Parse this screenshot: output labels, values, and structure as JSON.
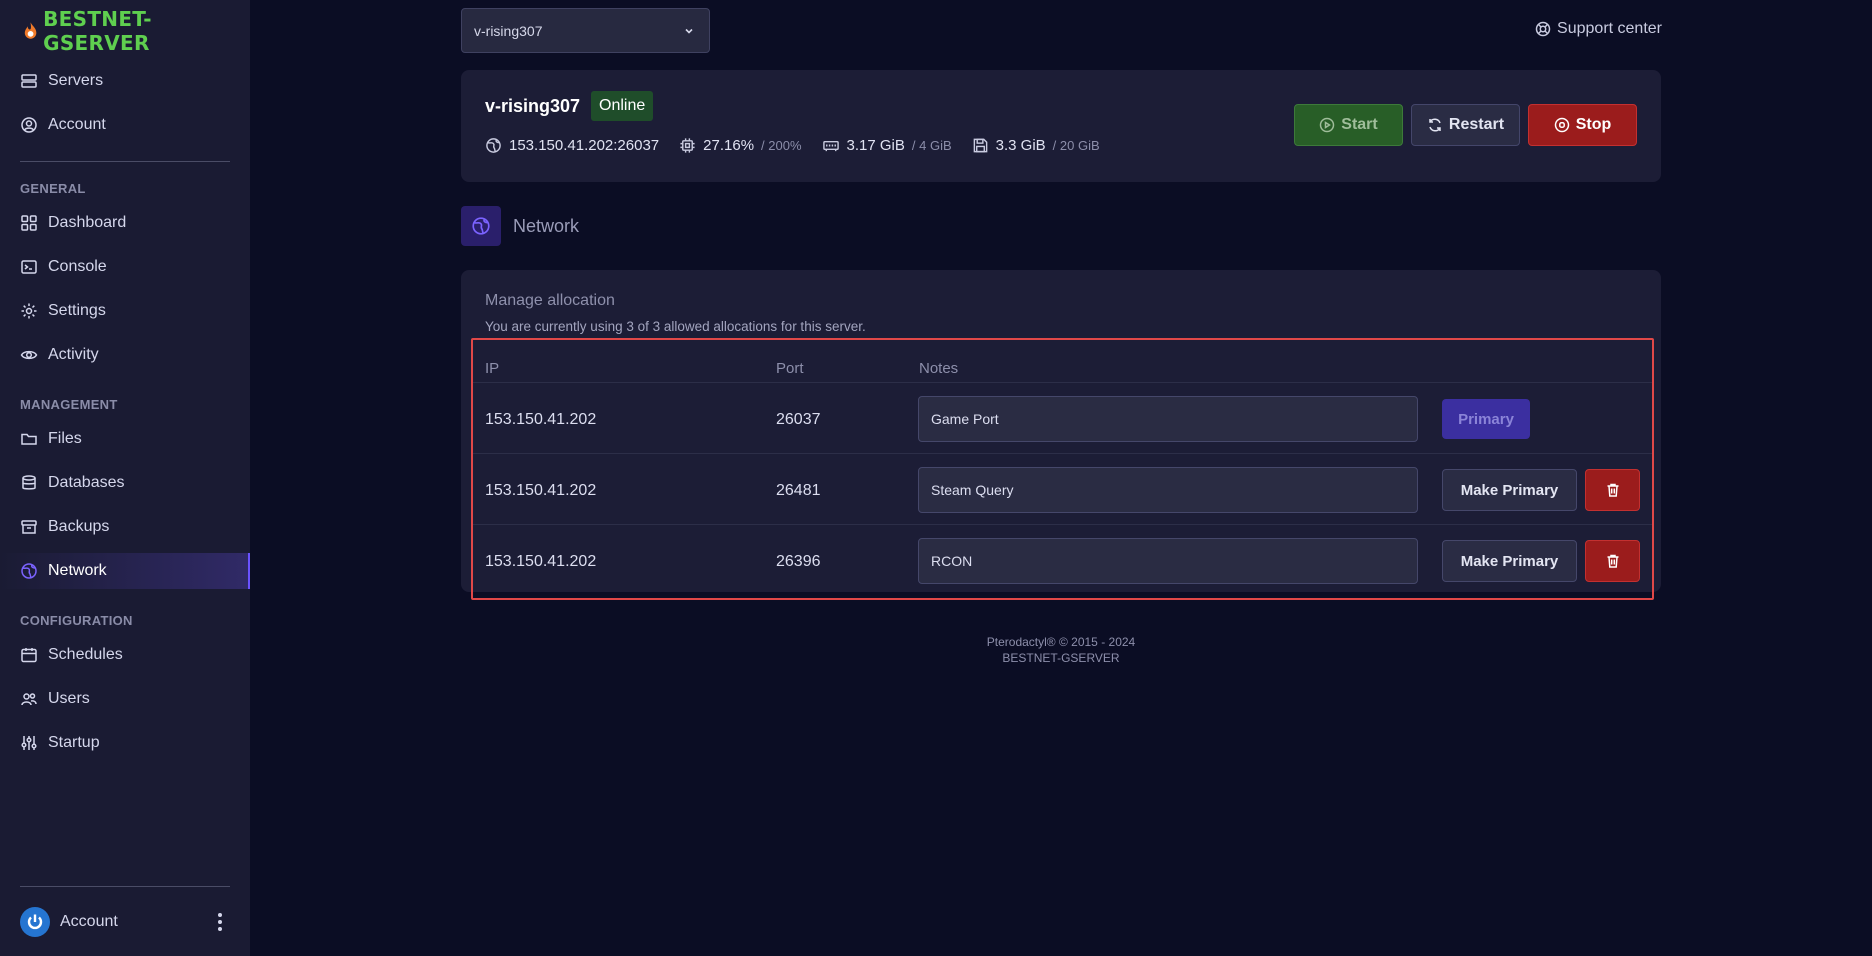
{
  "brand": {
    "name": "BESTNET-GSERVER",
    "color": "#5fcf4f"
  },
  "sidebar": {
    "top_items": [
      {
        "label": "Servers",
        "icon": "server-icon"
      },
      {
        "label": "Account",
        "icon": "user-circle-icon"
      }
    ],
    "sections": [
      {
        "label": "GENERAL",
        "items": [
          {
            "label": "Dashboard",
            "icon": "grid-icon"
          },
          {
            "label": "Console",
            "icon": "terminal-icon"
          },
          {
            "label": "Settings",
            "icon": "gear-icon"
          },
          {
            "label": "Activity",
            "icon": "eye-icon"
          }
        ]
      },
      {
        "label": "MANAGEMENT",
        "items": [
          {
            "label": "Files",
            "icon": "folder-icon"
          },
          {
            "label": "Databases",
            "icon": "database-icon"
          },
          {
            "label": "Backups",
            "icon": "archive-icon"
          },
          {
            "label": "Network",
            "icon": "globe-icon",
            "active": true
          }
        ]
      },
      {
        "label": "CONFIGURATION",
        "items": [
          {
            "label": "Schedules",
            "icon": "calendar-icon"
          },
          {
            "label": "Users",
            "icon": "users-icon"
          },
          {
            "label": "Startup",
            "icon": "sliders-icon"
          }
        ]
      }
    ],
    "account_label": "Account"
  },
  "topbar": {
    "server_select_value": "v-rising307",
    "support_label": "Support center"
  },
  "server": {
    "name": "v-rising307",
    "status": "Online",
    "address": "153.150.41.202:26037",
    "cpu": "27.16%",
    "cpu_limit": "/ 200%",
    "memory": "3.17 GiB",
    "memory_limit": "/ 4 GiB",
    "disk": "3.3 GiB",
    "disk_limit": "/ 20 GiB",
    "buttons": {
      "start": "Start",
      "restart": "Restart",
      "stop": "Stop"
    },
    "colors": {
      "start": "#285e27",
      "stop": "#9b1c1c",
      "online": "#1f4d2a"
    }
  },
  "page": {
    "title": "Network"
  },
  "allocations": {
    "title": "Manage allocation",
    "subtitle": "You are currently using 3 of 3 allowed allocations for this server.",
    "headers": {
      "ip": "IP",
      "port": "Port",
      "notes": "Notes"
    },
    "rows": [
      {
        "ip": "153.150.41.202",
        "port": "26037",
        "note": "Game Port",
        "primary": true,
        "action": "Primary"
      },
      {
        "ip": "153.150.41.202",
        "port": "26481",
        "note": "Steam Query",
        "primary": false,
        "action": "Make Primary"
      },
      {
        "ip": "153.150.41.202",
        "port": "26396",
        "note": "RCON",
        "primary": false,
        "action": "Make Primary"
      }
    ]
  },
  "footer": {
    "line1": "Pterodactyl® © 2015 - 2024",
    "line2": "BESTNET-GSERVER"
  }
}
